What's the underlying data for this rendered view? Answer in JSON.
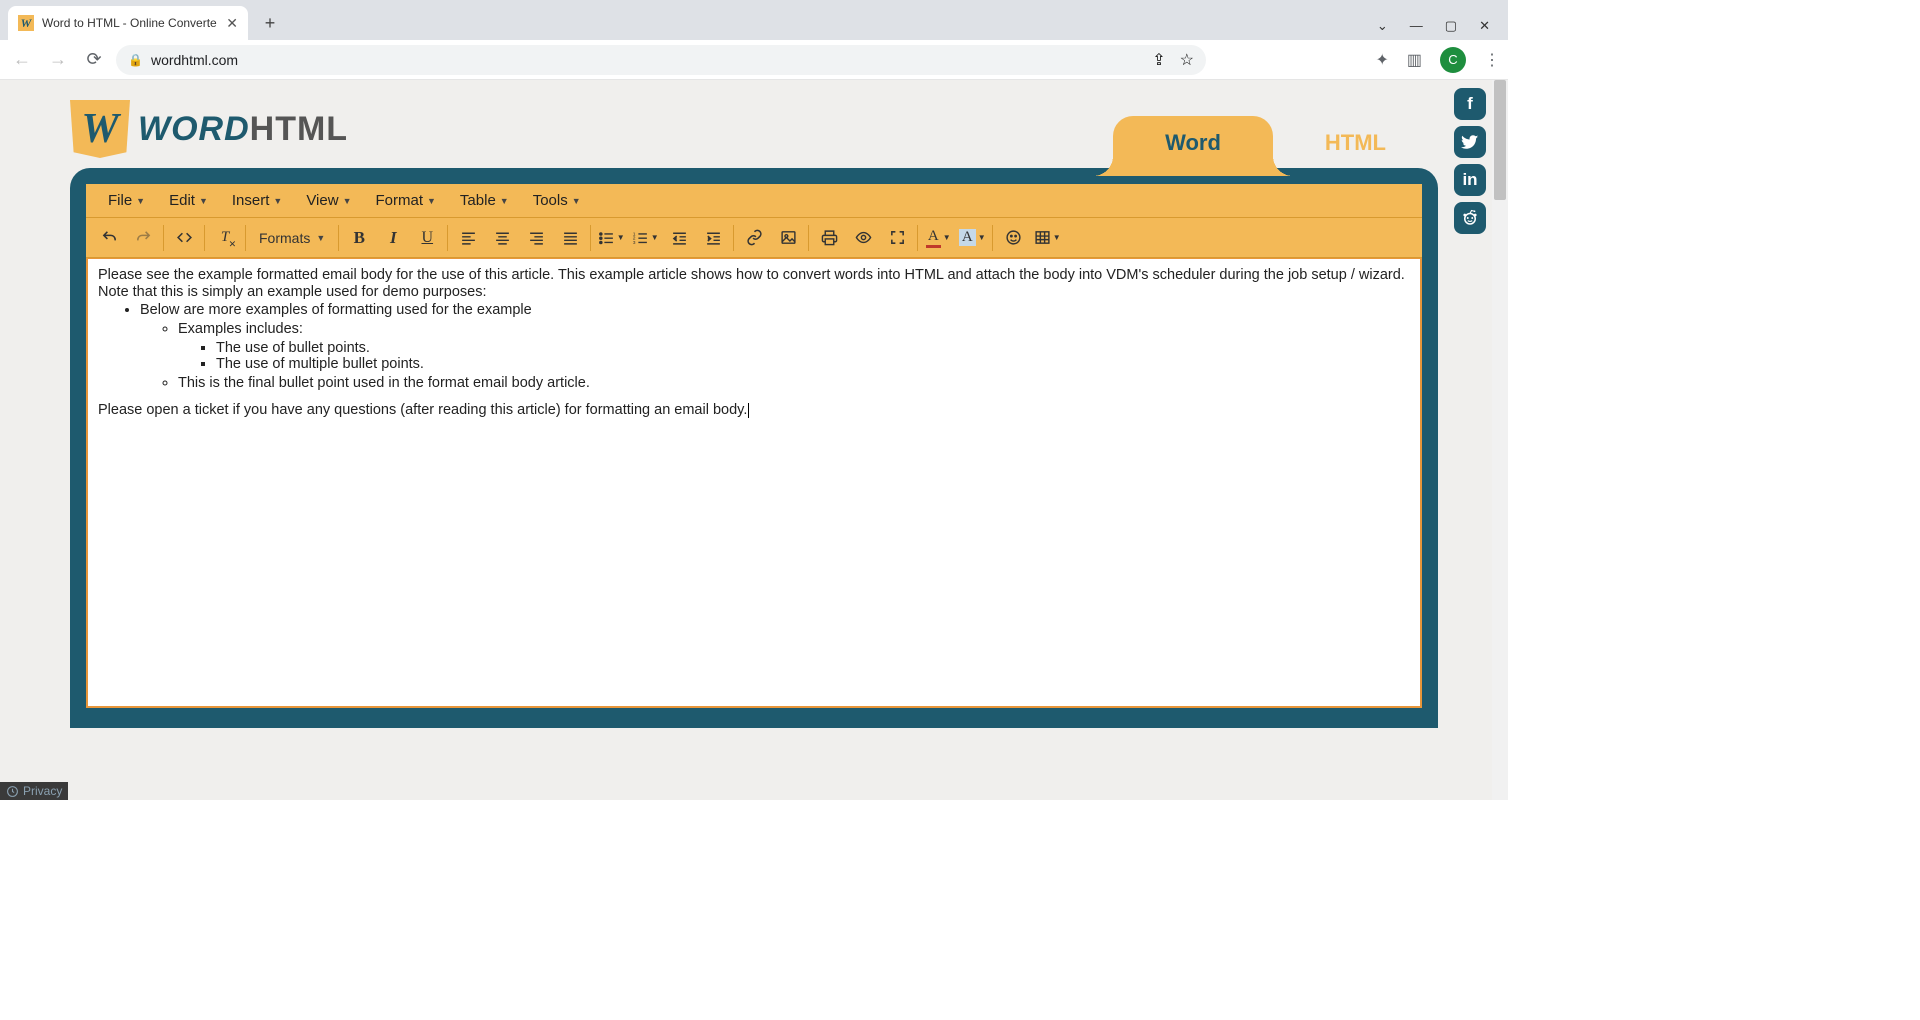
{
  "browser": {
    "tab_title": "Word to HTML - Online Converte",
    "url": "wordhtml.com",
    "avatar_letter": "C"
  },
  "logo": {
    "word": "WORD",
    "html": "HTML"
  },
  "social": [
    "f",
    "t",
    "in",
    "r"
  ],
  "tabs": {
    "word": "Word",
    "html": "HTML"
  },
  "menus": [
    "File",
    "Edit",
    "Insert",
    "View",
    "Format",
    "Table",
    "Tools"
  ],
  "formats_label": "Formats",
  "content": {
    "p1": "Please see the example formatted email body for the use of this article. This example article shows how to convert words into HTML and attach the body into VDM's scheduler during the job setup / wizard. Note that this is simply an example used for demo purposes:",
    "b1": "Below are more examples of formatting used for the example",
    "b1_1": "Examples includes:",
    "b1_1_1": "The use of bullet points.",
    "b1_1_2": "The use of multiple bullet points.",
    "b1_2": "This is the final bullet point used in the format email body article.",
    "p2": "Please open a ticket if you have any questions (after reading this article) for formatting an email body."
  },
  "privacy": "Privacy"
}
